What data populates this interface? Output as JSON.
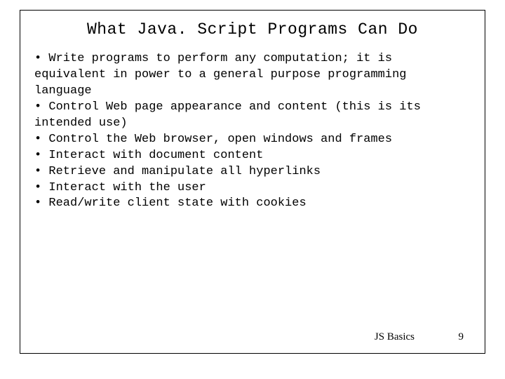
{
  "title": "What Java. Script Programs Can Do",
  "bullets": [
    " • Write programs to perform any computation; it is equivalent in power to a general purpose programming language",
    " • Control Web page appearance and content (this is its intended use)",
    " • Control the Web browser, open windows and frames",
    " • Interact with document content",
    " • Retrieve and manipulate all hyperlinks",
    " • Interact with the user",
    " • Read/write client state with cookies"
  ],
  "footer": {
    "label": "JS Basics",
    "page": "9"
  }
}
